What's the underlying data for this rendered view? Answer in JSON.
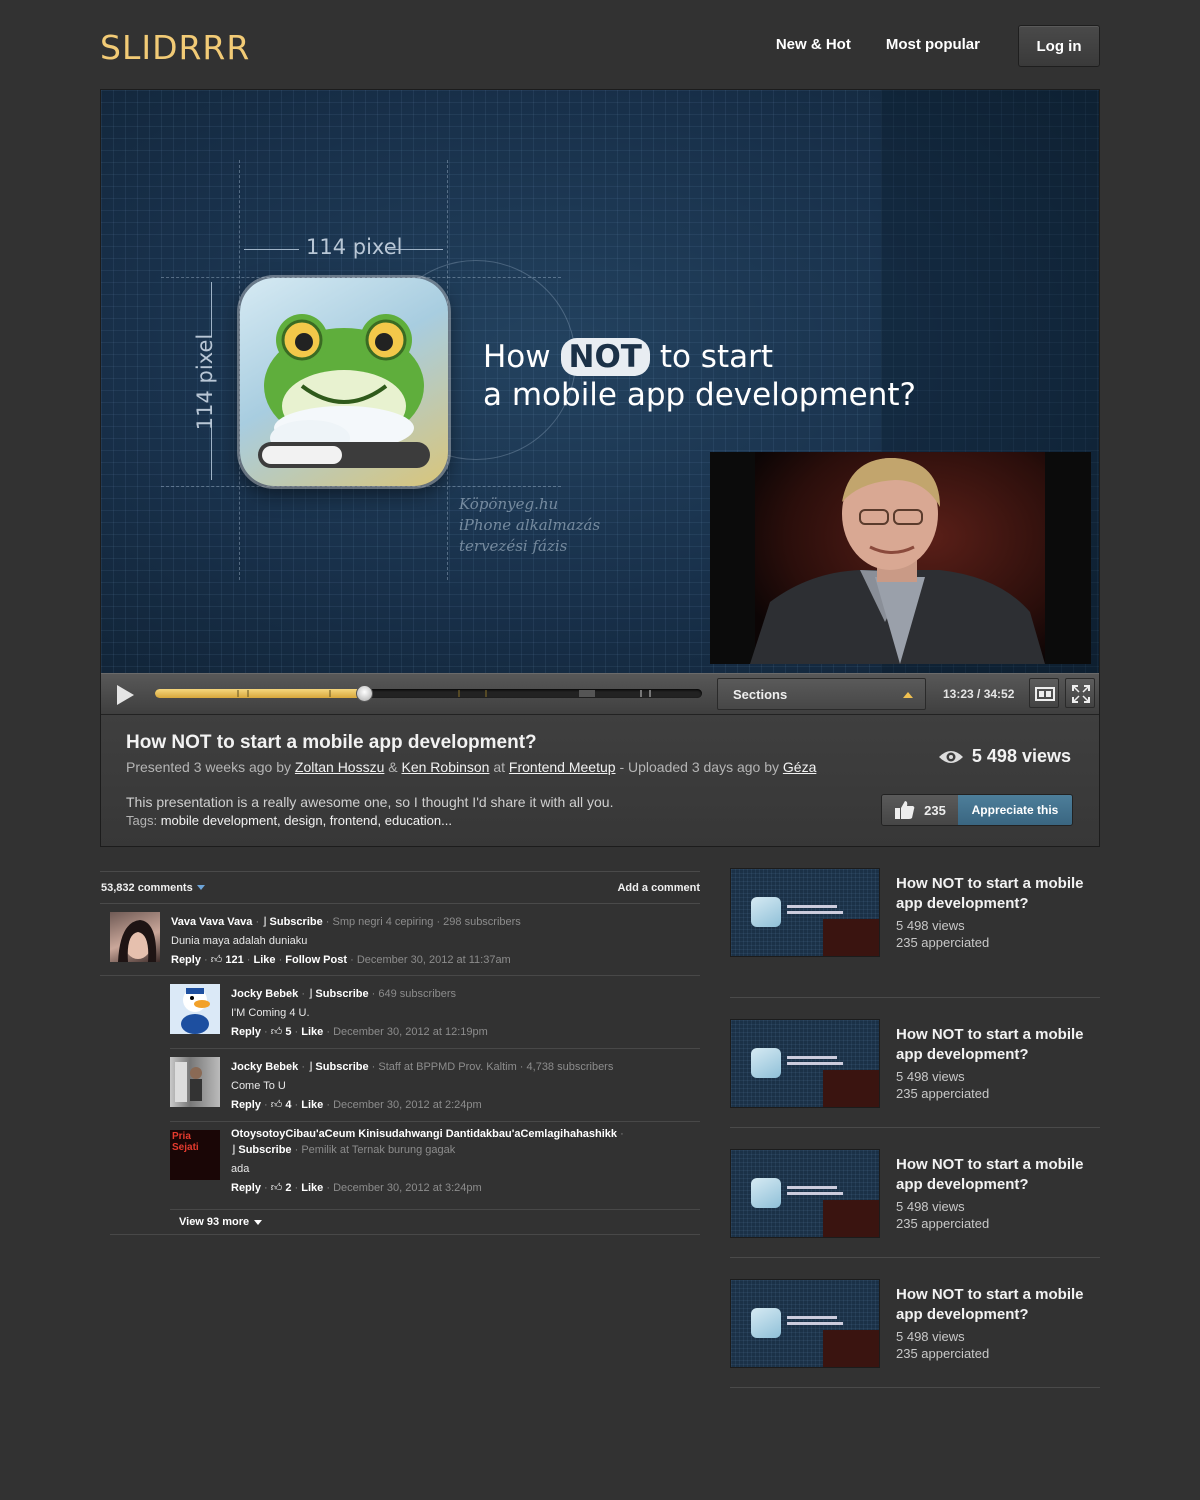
{
  "header": {
    "logo": "SLIDRRR",
    "nav": [
      "New & Hot",
      "Most popular"
    ],
    "login_label": "Log in"
  },
  "slide": {
    "dimension_label_h": "114 pixel",
    "dimension_label_v": "114 pixel",
    "title_prefix": "How",
    "title_highlight": "NOT",
    "title_suffix": "to start",
    "title_line2": "a mobile app development?",
    "note_line1": "Köpönyeg.hu",
    "note_line2": "iPhone alkalmazás",
    "note_line3": "tervezési fázis"
  },
  "controls": {
    "sections_label": "Sections",
    "time": "13:23 / 34:52",
    "progress_fraction": 0.384
  },
  "video": {
    "title": "How NOT to start a mobile app development?",
    "presented": "Presented 3 weeks ago by",
    "presenter1": "Zoltan Hosszu",
    "amp": "&",
    "presenter2": "Ken Robinson",
    "at": "at",
    "event": "Frontend Meetup",
    "uploaded": "- Uploaded 3 days ago by",
    "uploader": "Géza",
    "description": "This presentation is a really awesome one, so I thought I'd share it with all you.",
    "tags_label": "Tags:",
    "tags": "mobile development, design, frontend, education...",
    "views": "5 498 views",
    "appreciate_count": "235",
    "appreciate_label": "Appreciate this"
  },
  "comments": {
    "count_label": "53,832 comments",
    "add_label": "Add a comment",
    "view_more": "View 93 more",
    "items": [
      {
        "name": "Vava Vava Vava",
        "subscribe": "Subscribe",
        "meta": "· Smp negri 4 cepiring · 298 subscribers",
        "text": "Dunia maya adalah duniaku",
        "reply": "Reply",
        "likes": "121",
        "like": "Like",
        "follow": "Follow Post",
        "date": "December 30, 2012 at 11:37am"
      },
      {
        "name": "Jocky Bebek",
        "subscribe": "Subscribe",
        "meta": "· 649 subscribers",
        "text": "I'M Coming 4 U.",
        "reply": "Reply",
        "likes": "5",
        "like": "Like",
        "date": "December 30, 2012 at 12:19pm"
      },
      {
        "name": "Jocky Bebek",
        "subscribe": "Subscribe",
        "meta": "· Staff at BPPMD Prov. Kaltim · 4,738 subscribers",
        "text": "Come To U",
        "reply": "Reply",
        "likes": "4",
        "like": "Like",
        "date": "December 30, 2012 at 2:24pm"
      },
      {
        "name": "OtoysotoyCibau'aCeum Kinisudahwangi Dantidakbau'aCemlagihahashikk",
        "subscribe": "Subscribe",
        "meta": "· Pemilik at Ternak burung gagak",
        "text": "ada",
        "reply": "Reply",
        "likes": "2",
        "like": "Like",
        "date": "December 30, 2012 at 3:24pm",
        "avatar_text": "Pria Sejati"
      }
    ]
  },
  "related": [
    {
      "title": "How NOT to start a mobile app development?",
      "views": "5 498 views",
      "appreciated": "235 apperciated"
    },
    {
      "title": "How NOT to start a mobile app development?",
      "views": "5 498 views",
      "appreciated": "235 apperciated"
    },
    {
      "title": "How NOT to start a mobile app development?",
      "views": "5 498 views",
      "appreciated": "235 apperciated"
    },
    {
      "title": "How NOT to start a mobile app development?",
      "views": "5 498 views",
      "appreciated": "235 apperciated"
    }
  ],
  "colors": {
    "logo": "#f2cb76",
    "progress": "#e2bb55",
    "appreciate": "#4a7a96",
    "background": "#323232"
  }
}
